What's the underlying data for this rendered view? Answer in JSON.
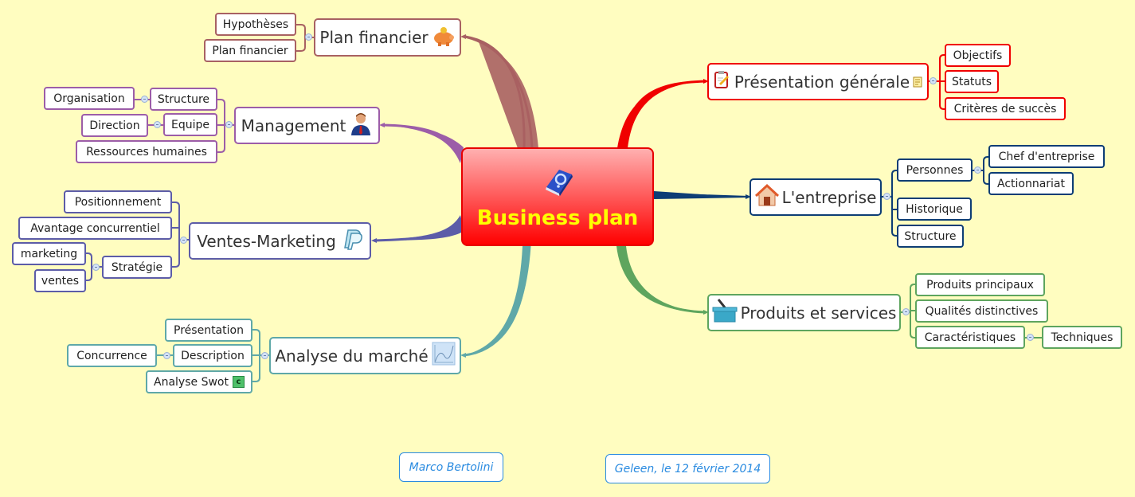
{
  "central": {
    "title": "Business plan",
    "icon": "help-book-icon"
  },
  "branches": {
    "plan_financier": {
      "label": "Plan financier",
      "icon": "piggy-bank-icon",
      "color": "#a86162",
      "children": [
        "Hypothèses",
        "Plan financier"
      ]
    },
    "management": {
      "label": "Management",
      "icon": "businessman-icon",
      "color": "#9c5da8",
      "children": {
        "structure": {
          "label": "Structure",
          "children": [
            "Organisation"
          ]
        },
        "equipe": {
          "label": "Equipe",
          "children": [
            "Direction"
          ]
        },
        "rh": {
          "label": "Ressources humaines"
        }
      }
    },
    "ventes_marketing": {
      "label": "Ventes-Marketing",
      "icon": "paypal-p-icon",
      "color": "#5c5ca8",
      "children": {
        "positionnement": {
          "label": "Positionnement"
        },
        "avantage": {
          "label": "Avantage concurrentiel"
        },
        "strategie": {
          "label": "Stratégie",
          "children": [
            "marketing",
            "ventes"
          ]
        }
      }
    },
    "analyse_marche": {
      "label": "Analyse du marché",
      "icon": "chart-curve-icon",
      "color": "#5fa8a8",
      "children": {
        "presentation": {
          "label": "Présentation"
        },
        "description": {
          "label": "Description",
          "children": [
            "Concurrence"
          ]
        },
        "swot": {
          "label": "Analyse Swot",
          "icon": "c-badge-icon"
        }
      }
    },
    "presentation_generale": {
      "label": "Présentation générale",
      "icon": "clipboard-edit-icon",
      "note_icon": "note-icon",
      "color": "#f00000",
      "children": [
        "Objectifs",
        "Statuts",
        "Critères de succès"
      ]
    },
    "entreprise": {
      "label": "L'entreprise",
      "icon": "house-icon",
      "color": "#0d3d75",
      "children": {
        "personnes": {
          "label": "Personnes",
          "children": [
            "Chef d'entreprise",
            "Actionnariat"
          ]
        },
        "historique": {
          "label": "Historique"
        },
        "structure": {
          "label": "Structure"
        }
      }
    },
    "produits_services": {
      "label": "Produits et services",
      "icon": "basket-icon",
      "color": "#5ea55e",
      "children": {
        "principaux": {
          "label": "Produits principaux"
        },
        "qualites": {
          "label": "Qualités distinctives"
        },
        "caracteristiques": {
          "label": "Caractéristiques",
          "children": [
            "Techniques"
          ]
        }
      }
    }
  },
  "footer": {
    "author": "Marco Bertolini",
    "place_date": "Geleen, le 12 février 2014"
  }
}
